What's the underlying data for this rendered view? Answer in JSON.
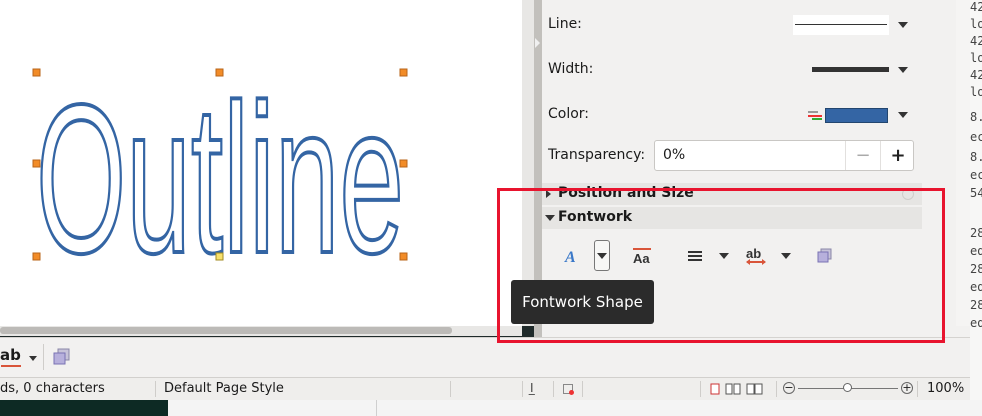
{
  "canvas": {
    "outline_text": "Outline"
  },
  "sidebar": {
    "line": {
      "label": "Line:"
    },
    "width": {
      "label": "Width:"
    },
    "color": {
      "label": "Color:",
      "swatch": "#3465a4"
    },
    "transparency": {
      "label": "Transparency:",
      "value": "0%",
      "minus": "−",
      "plus": "+"
    },
    "panels": {
      "position_size": {
        "label": "Position and Size"
      },
      "fontwork": {
        "label": "Fontwork"
      }
    }
  },
  "tooltip": {
    "text": "Fontwork Shape"
  },
  "toolbar": {
    "text_label": "ab"
  },
  "statusbar": {
    "words": "ds, 0 characters",
    "page_style": "Default Page Style",
    "zoom": "100%"
  },
  "right_edge_lines": [
    "42",
    "lo",
    "42",
    "lo",
    "42",
    "lo",
    "8.",
    "ec",
    "8.",
    "ec",
    "54",
    "",
    "28",
    "ed",
    "28",
    "ed",
    "28",
    "ed"
  ],
  "colors": {
    "highlight": "#e8142e",
    "accent": "#3465a4"
  }
}
